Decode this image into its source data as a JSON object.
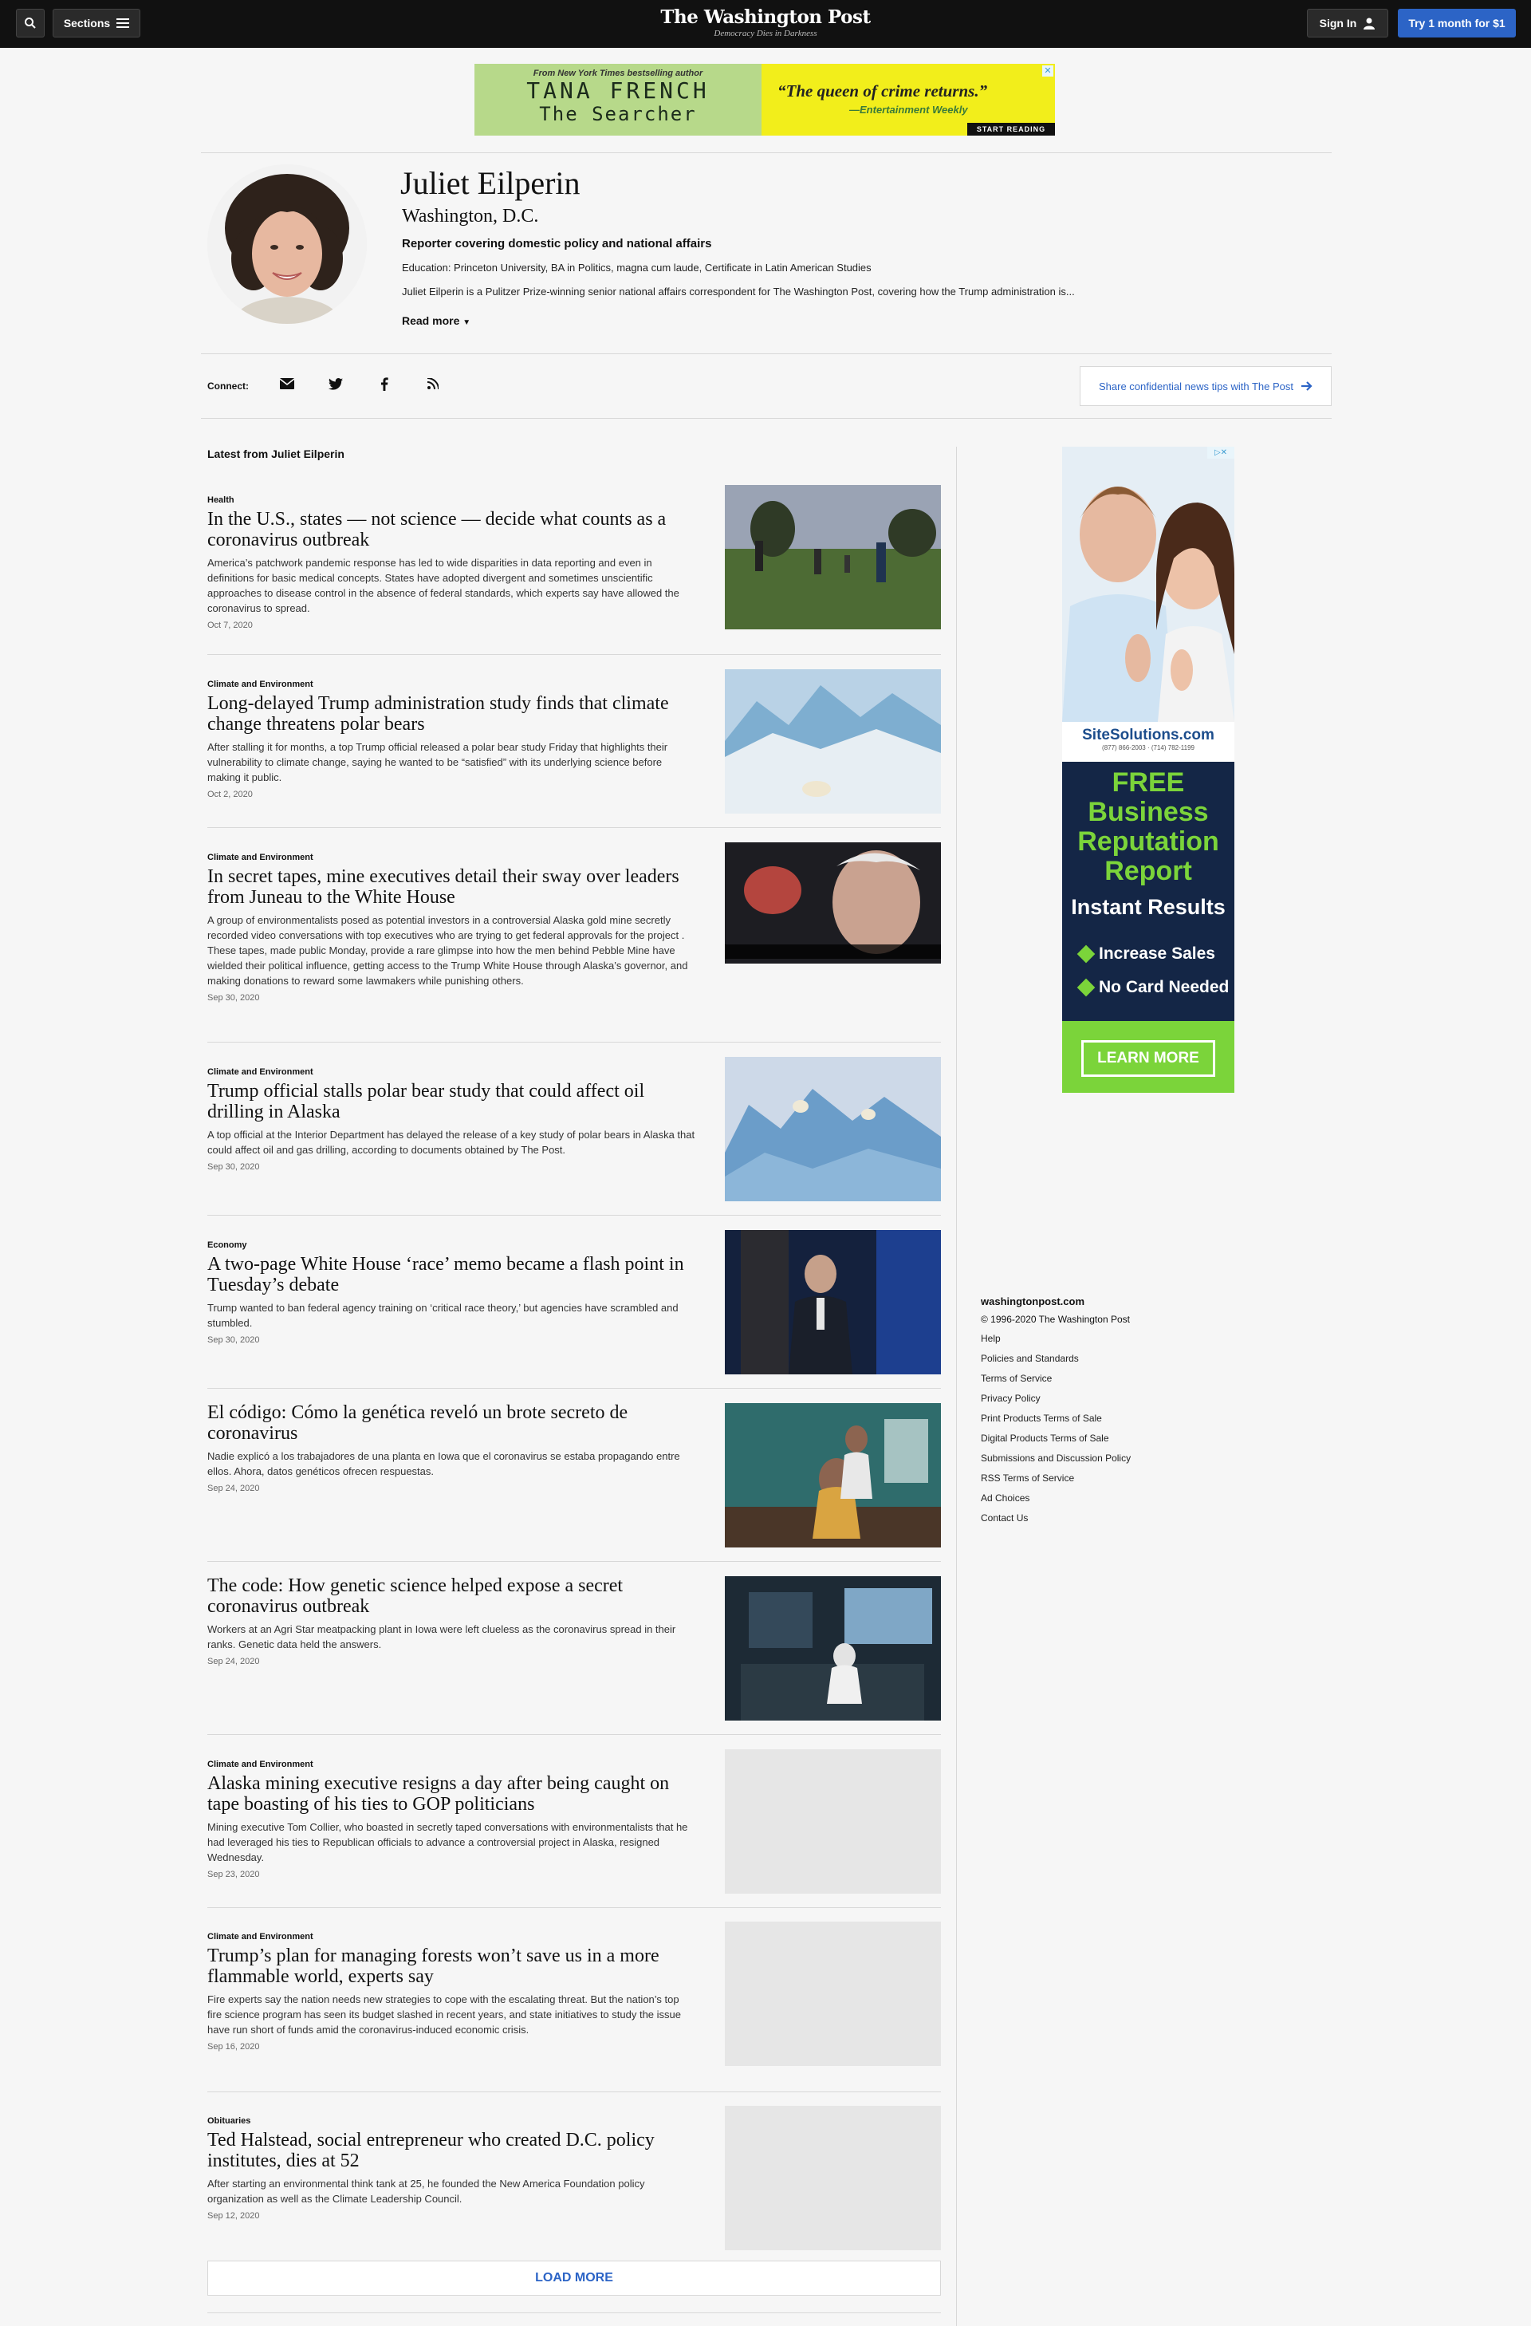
{
  "nav": {
    "sections_label": "Sections",
    "signin_label": "Sign In",
    "try_label": "Try 1 month for $1",
    "logo_title": "The Washington Post",
    "logo_tagline": "Democracy Dies in Darkness"
  },
  "top_ad": {
    "kicker": "From New York Times bestselling author",
    "author": "TANA FRENCH",
    "book": "The Searcher",
    "quote": "“The queen of crime returns.”",
    "credit": "—Entertainment Weekly",
    "cta": "START READING",
    "close": "✕"
  },
  "author": {
    "name": "Juliet Eilperin",
    "location": "Washington, D.C.",
    "role": "Reporter covering domestic policy and national affairs",
    "education": "Education: Princeton University, BA in Politics, magna cum laude, Certificate in Latin American Studies",
    "bio": "Juliet Eilperin is a Pulitzer Prize-winning senior national affairs correspondent for The Washington Post, covering how the Trump administration is...",
    "read_more": "Read more"
  },
  "connect": {
    "label": "Connect:",
    "icons": [
      "mail-icon",
      "twitter-icon",
      "facebook-icon",
      "rss-icon"
    ],
    "tips": "Share confidential news tips with The Post"
  },
  "latest_label": "Latest from Juliet Eilperin",
  "articles": [
    {
      "kicker": "Health",
      "headline": "In the U.S., states — not science — decide what counts as a coronavirus outbreak",
      "blurb": "America’s patchwork pandemic response has led to wide disparities in data reporting and even in definitions for basic medical concepts. States have adopted divergent and sometimes unscientific approaches to disease control in the absence of federal standards, which experts say have allowed the coronavirus to spread.",
      "date": "Oct 7, 2020"
    },
    {
      "kicker": "Climate and Environment",
      "headline": "Long-delayed Trump administration study finds that climate change threatens polar bears",
      "blurb": "After stalling it for months, a top Trump official released a polar bear study Friday that highlights their vulnerability to climate change, saying he wanted to be “satisfied” with its underlying science before making it public.",
      "date": "Oct 2, 2020"
    },
    {
      "kicker": "Climate and Environment",
      "headline": "In secret tapes, mine executives detail their sway over leaders from Juneau to the White House",
      "blurb": "A group of environmentalists posed as potential investors in a controversial Alaska gold mine secretly recorded video conversations with top executives who are trying to get federal approvals for the project . These tapes, made public Monday, provide a rare glimpse into how the men behind Pebble Mine have wielded their political influence, getting access to the Trump White House through Alaska’s governor, and making donations to reward some lawmakers while punishing others.",
      "date": "Sep 30, 2020"
    },
    {
      "kicker": "Climate and Environment",
      "headline": "Trump official stalls polar bear study that could affect oil drilling in Alaska",
      "blurb": "A top official at the Interior Department has delayed the release of a key study of polar bears in Alaska that could affect oil and gas drilling, according to documents obtained by The Post.",
      "date": "Sep 30, 2020"
    },
    {
      "kicker": "Economy",
      "headline": "A two-page White House ‘race’ memo became a flash point in Tuesday’s debate",
      "blurb": "Trump wanted to ban federal agency training on ‘critical race theory,’ but agencies have scrambled and stumbled.",
      "date": "Sep 30, 2020"
    },
    {
      "kicker": "",
      "headline": "El código: Cómo la genética reveló un brote secreto de coronavirus",
      "blurb": "Nadie explicó a los trabajadores de una planta en Iowa que el coronavirus se estaba propagando entre ellos. Ahora, datos genéticos ofrecen respuestas.",
      "date": "Sep 24, 2020"
    },
    {
      "kicker": "",
      "headline": "The code: How genetic science helped expose a secret coronavirus outbreak",
      "blurb": "Workers at an Agri Star meatpacking plant in Iowa were left clueless as the coronavirus spread in their ranks. Genetic data held the answers.",
      "date": "Sep 24, 2020"
    },
    {
      "kicker": "Climate and Environment",
      "headline": "Alaska mining executive resigns a day after being caught on tape boasting of his ties to GOP politicians",
      "blurb": "Mining executive Tom Collier, who boasted in secretly taped conversations with environmentalists that he had leveraged his ties to Republican officials to advance a controversial project in Alaska, resigned Wednesday.",
      "date": "Sep 23, 2020"
    },
    {
      "kicker": "Climate and Environment",
      "headline": "Trump’s plan for managing forests won’t save us in a more flammable world, experts say",
      "blurb": "Fire experts say the nation needs new strategies to cope with the escalating threat. But the nation’s top fire science program has seen its budget slashed in recent years, and state initiatives to study the issue have run short of funds amid the coronavirus-induced economic crisis.",
      "date": "Sep 16, 2020"
    },
    {
      "kicker": "Obituaries",
      "headline": "Ted Halstead, social entrepreneur who created D.C. policy institutes, dies at 52",
      "blurb": "After starting an environmental think tank at 25, he founded the New America Foundation policy organization as well as the Climate Leadership Council.",
      "date": "Sep 12, 2020"
    }
  ],
  "load_more": "LOAD MORE",
  "side_ad": {
    "brand": "SiteSolutions.com",
    "phone": "(877) 866-2003 · (714) 782-1199",
    "offer_lines": [
      "FREE",
      "Business",
      "Reputation",
      "Report"
    ],
    "instant": "Instant Results",
    "bullets": [
      "Increase Sales",
      "No Card Needed"
    ],
    "cta": "LEARN MORE",
    "choices": "▷✕"
  },
  "footer": {
    "site": "washingtonpost.com",
    "copyright": "© 1996-2020 The Washington Post",
    "links": [
      "Help",
      "Policies and Standards",
      "Terms of Service",
      "Privacy Policy",
      "Print Products Terms of Sale",
      "Digital Products Terms of Sale",
      "Submissions and Discussion Policy",
      "RSS Terms of Service",
      "Ad Choices",
      "Contact Us"
    ]
  },
  "colors": {
    "accent": "#2c64c6",
    "topbar": "#111111",
    "ad_green": "#7bd43a",
    "ad_navy": "#142646"
  }
}
